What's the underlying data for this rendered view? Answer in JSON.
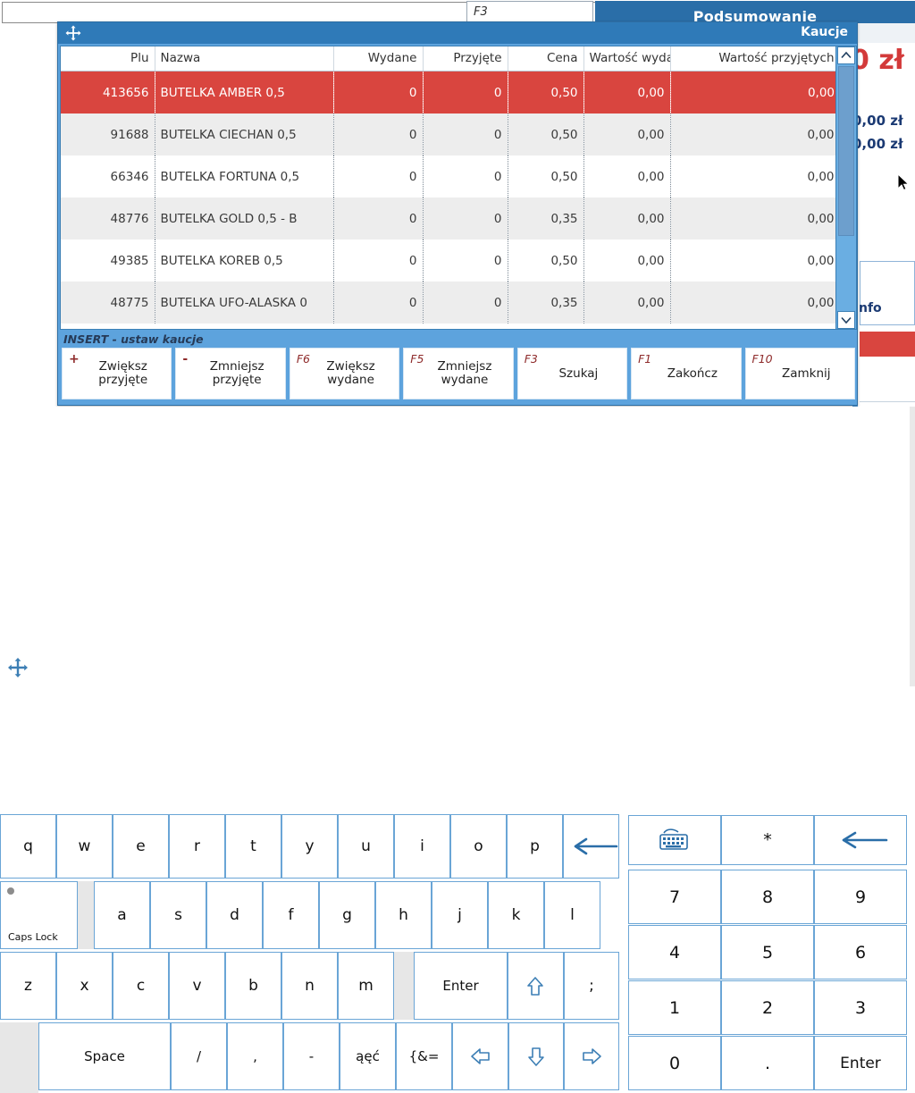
{
  "background": {
    "f3_field_label": "F3",
    "podsumowanie_title": "Podsumowanie",
    "amount_big": "0 zł",
    "amount_a": "0,00 zł",
    "amount_b": "0,00 zł",
    "info_label": "nfo"
  },
  "dialog": {
    "title": "Kaucje",
    "move_icon": "move-icon",
    "insert_hint": "INSERT - ustaw kaucje",
    "columns": [
      {
        "key": "plu",
        "label": "Plu",
        "align": "right"
      },
      {
        "key": "nazwa",
        "label": "Nazwa",
        "align": "left"
      },
      {
        "key": "wyd",
        "label": "Wydane",
        "align": "right"
      },
      {
        "key": "prz",
        "label": "Przyjęte",
        "align": "right"
      },
      {
        "key": "cena",
        "label": "Cena",
        "align": "right"
      },
      {
        "key": "wwyd",
        "label": "Wartość wyda",
        "align": "right"
      },
      {
        "key": "wprz",
        "label": "Wartość przyjętych",
        "align": "right"
      }
    ],
    "rows": [
      {
        "plu": "413656",
        "nazwa": "BUTELKA AMBER 0,5",
        "wyd": "0",
        "prz": "0",
        "cena": "0,50",
        "wwyd": "0,00",
        "wprz": "0,00",
        "selected": true
      },
      {
        "plu": "91688",
        "nazwa": "BUTELKA CIECHAN 0,5",
        "wyd": "0",
        "prz": "0",
        "cena": "0,50",
        "wwyd": "0,00",
        "wprz": "0,00",
        "selected": false
      },
      {
        "plu": "66346",
        "nazwa": "BUTELKA FORTUNA 0,5",
        "wyd": "0",
        "prz": "0",
        "cena": "0,50",
        "wwyd": "0,00",
        "wprz": "0,00",
        "selected": false
      },
      {
        "plu": "48776",
        "nazwa": "BUTELKA GOLD 0,5 - B",
        "wyd": "0",
        "prz": "0",
        "cena": "0,35",
        "wwyd": "0,00",
        "wprz": "0,00",
        "selected": false
      },
      {
        "plu": "49385",
        "nazwa": "BUTELKA KOREB 0,5",
        "wyd": "0",
        "prz": "0",
        "cena": "0,50",
        "wwyd": "0,00",
        "wprz": "0,00",
        "selected": false
      },
      {
        "plu": "48775",
        "nazwa": "BUTELKA UFO-ALASKA 0",
        "wyd": "0",
        "prz": "0",
        "cena": "0,35",
        "wwyd": "0,00",
        "wprz": "0,00",
        "selected": false
      }
    ],
    "function_buttons": [
      {
        "key": "+",
        "label": "Zwiększ\nprzyjęte",
        "line1": "Zwiększ",
        "line2": "przyjęte",
        "plain": true
      },
      {
        "key": "-",
        "label": "Zmniejsz\nprzyjęte",
        "line1": "Zmniejsz",
        "line2": "przyjęte",
        "plain": true
      },
      {
        "key": "F6",
        "label": "Zwiększ\nwydane",
        "line1": "Zwiększ",
        "line2": "wydane",
        "plain": false
      },
      {
        "key": "F5",
        "label": "Zmniejsz\nwydane",
        "line1": "Zmniejsz",
        "line2": "wydane",
        "plain": false
      },
      {
        "key": "F3",
        "label": "Szukaj",
        "line1": "Szukaj",
        "line2": "",
        "plain": false
      },
      {
        "key": "F1",
        "label": "Zakończ",
        "line1": "Zakończ",
        "line2": "",
        "plain": false
      },
      {
        "key": "F10",
        "label": "Zamknij",
        "line1": "Zamknij",
        "line2": "",
        "plain": false
      }
    ],
    "scrollbar": {
      "up_icon": "chevron-up-icon",
      "down_icon": "chevron-down-icon"
    }
  },
  "keyboard": {
    "row1": [
      "q",
      "w",
      "e",
      "r",
      "t",
      "y",
      "u",
      "i",
      "o",
      "p"
    ],
    "row1_backspace_icon": "backspace-arrow-icon",
    "caps_lock": "Caps Lock",
    "row2": [
      "a",
      "s",
      "d",
      "f",
      "g",
      "h",
      "j",
      "k",
      "l"
    ],
    "row3": [
      "z",
      "x",
      "c",
      "v",
      "b",
      "n",
      "m"
    ],
    "enter": "Enter",
    "shift_icon": "shift-up-arrow-icon",
    "semicolon": ";",
    "space": "Space",
    "row4_extra": [
      "/",
      ",",
      "-",
      "ąęć",
      "{&="
    ],
    "arrow_left_icon": "arrow-left-icon",
    "arrow_down_icon": "arrow-down-icon",
    "arrow_right_icon": "arrow-right-icon",
    "move_icon": "move-icon"
  },
  "numpad": {
    "keyboard_toggle_icon": "keyboard-icon",
    "asterisk": "*",
    "backspace_icon": "backspace-arrow-icon",
    "digits": [
      "7",
      "8",
      "9",
      "4",
      "5",
      "6",
      "1",
      "2",
      "3"
    ],
    "zero": "0",
    "dot": ".",
    "enter": "Enter"
  },
  "colors": {
    "accent_blue": "#2f7ab8",
    "dialog_blue": "#5da3dd",
    "selection_red": "#d9453f",
    "key_border": "#6aa5d6",
    "fn_key_red": "#8e2a2a"
  }
}
